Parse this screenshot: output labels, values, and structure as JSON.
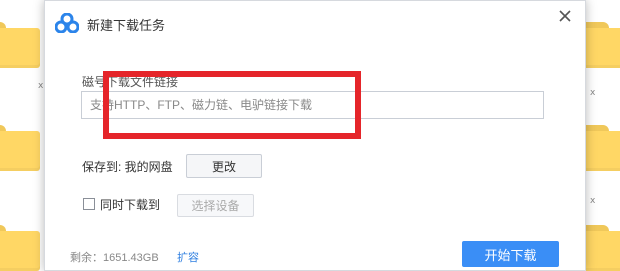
{
  "background": {
    "left_mark": "x",
    "side_marks": [
      "x",
      "x"
    ]
  },
  "dialog": {
    "title": "新建下载任务",
    "close_icon": "close-icon",
    "url_label": "磁号下载文件链接",
    "url_placeholder": "支持HTTP、FTP、磁力链、电驴链接下载",
    "save_label": "保存到: 我的网盘",
    "change_button": "更改",
    "simultaneous_label": "同时下载到",
    "select_device_button": "选择设备",
    "remaining": "剩余：1651.43GB",
    "expand_link": "扩容",
    "start_button": "开始下载"
  },
  "colors": {
    "accent": "#3a8ef6",
    "highlight": "#e5252a",
    "link": "#2f7fe0",
    "folder": "#ffd765"
  }
}
